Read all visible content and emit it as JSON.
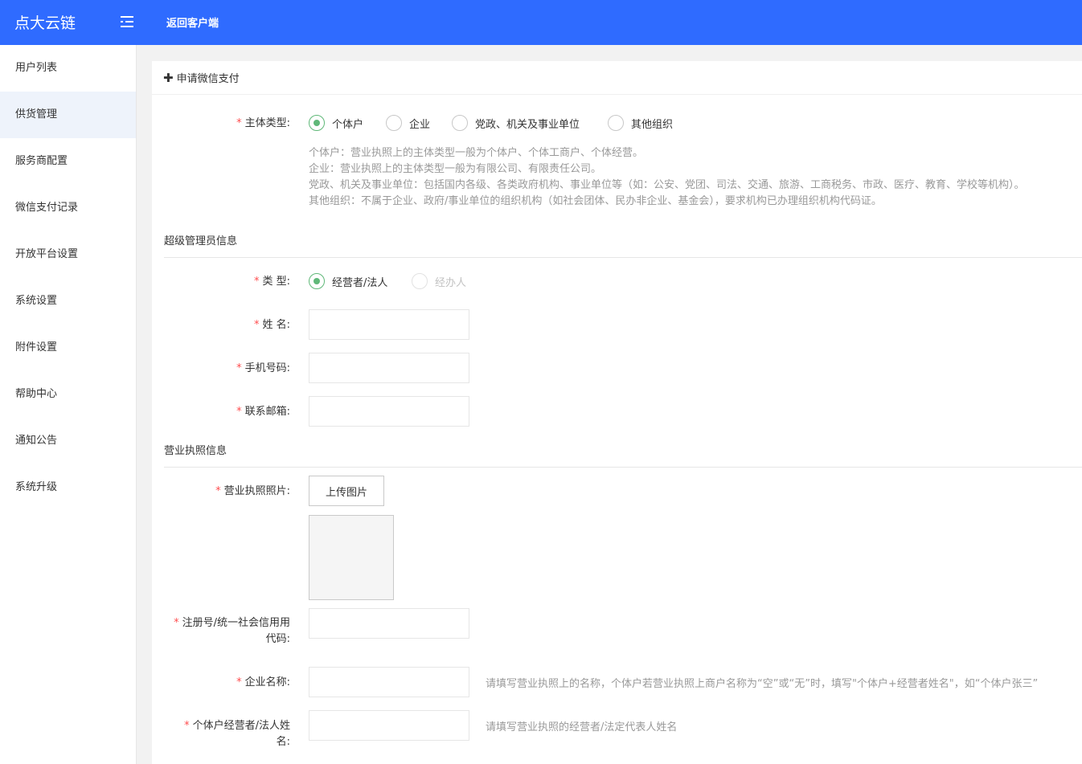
{
  "header": {
    "brand": "点大云链",
    "menu_toggle_icon": "menu-fold-icon",
    "back_link": "返回客户端",
    "color": "#2f6bff"
  },
  "sidebar": {
    "items": [
      {
        "label": "用户列表",
        "active": false
      },
      {
        "label": "供货管理",
        "active": true
      },
      {
        "label": "服务商配置",
        "active": false
      },
      {
        "label": "微信支付记录",
        "active": false
      },
      {
        "label": "开放平台设置",
        "active": false
      },
      {
        "label": "系统设置",
        "active": false
      },
      {
        "label": "附件设置",
        "active": false
      },
      {
        "label": "帮助中心",
        "active": false
      },
      {
        "label": "通知公告",
        "active": false
      },
      {
        "label": "系统升级",
        "active": false
      }
    ]
  },
  "card": {
    "plus_icon": "plus-icon",
    "title": "申请微信支付"
  },
  "form": {
    "required_mark": "*",
    "subject_type": {
      "label": "主体类型:",
      "options": [
        "个体户",
        "企业",
        "党政、机关及事业单位",
        "其他组织"
      ],
      "selected": "个体户"
    },
    "subject_hints": [
      "个体户：营业执照上的主体类型一般为个体户、个体工商户、个体经营。",
      "企业：营业执照上的主体类型一般为有限公司、有限责任公司。",
      "党政、机关及事业单位：包括国内各级、各类政府机构、事业单位等（如：公安、党团、司法、交通、旅游、工商税务、市政、医疗、教育、学校等机构）。",
      "其他组织：不属于企业、政府/事业单位的组织机构（如社会团体、民办非企业、基金会），要求机构已办理组织机构代码证。"
    ],
    "admin_section": "超级管理员信息",
    "admin_type": {
      "label": "类 型:",
      "options": [
        "经营者/法人",
        "经办人"
      ],
      "selected": "经营者/法人"
    },
    "name": {
      "label": "姓 名:",
      "value": ""
    },
    "phone": {
      "label": "手机号码:",
      "value": ""
    },
    "email": {
      "label": "联系邮箱:",
      "value": ""
    },
    "license_section": "营业执照信息",
    "license_photo": {
      "label": "营业执照照片:",
      "upload_label": "上传图片"
    },
    "reg_no": {
      "label_line1": "注册号/统一社会信用用",
      "label_line2": "代码:",
      "value": ""
    },
    "company_name": {
      "label": "企业名称:",
      "value": "",
      "hint": "请填写营业执照上的名称，个体户若营业执照上商户名称为“空”或“无”时，填写\"个体户+经营者姓名\"，如“个体户张三”"
    },
    "legal_name": {
      "label_line1": "个体户经营者/法人姓",
      "label_line2": "名:",
      "value": "",
      "hint": "请填写营业执照的经营者/法定代表人姓名"
    }
  }
}
